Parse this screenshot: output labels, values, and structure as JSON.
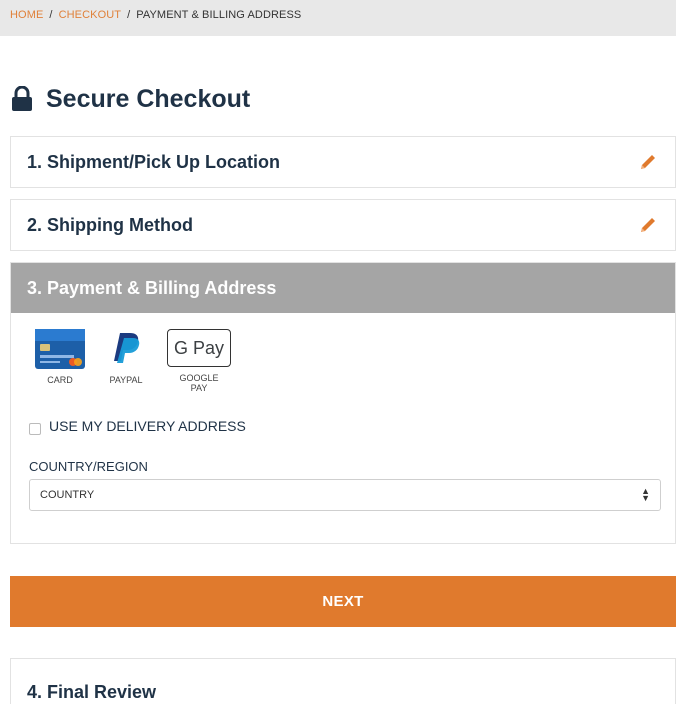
{
  "breadcrumb": {
    "home": "HOME",
    "checkout": "CHECKOUT",
    "current": "PAYMENT & BILLING ADDRESS",
    "separator": "/"
  },
  "page_title": "Secure Checkout",
  "steps": {
    "step1": "1. Shipment/Pick Up Location",
    "step2": "2. Shipping Method",
    "step3": "3. Payment & Billing Address",
    "step4": "4. Final Review"
  },
  "payment_methods": {
    "card": "CARD",
    "paypal": "PAYPAL",
    "google_pay_logo": "G Pay",
    "google_pay_line1": "GOOGLE",
    "google_pay_line2": "PAY"
  },
  "delivery_address_label": "USE MY DELIVERY ADDRESS",
  "country_label": "COUNTRY/REGION",
  "country_select_value": "COUNTRY",
  "next_button": "NEXT",
  "colors": {
    "accent": "#e07a2d",
    "title": "#1f3246",
    "active_header": "#a5a5a5",
    "breadcrumb_bg": "#e8e8e8"
  },
  "icons": {
    "title": "lock-icon",
    "edit": "pencil-icon",
    "select": "sort-arrows-icon"
  }
}
